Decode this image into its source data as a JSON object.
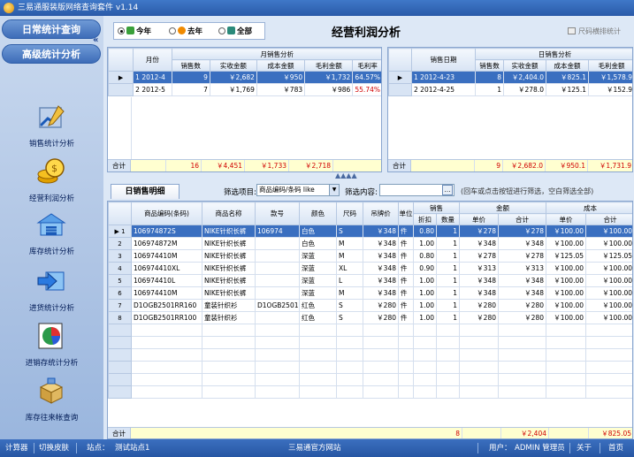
{
  "window": {
    "title": "三易通服装版网络查询套件  v1.14"
  },
  "sidebar": {
    "collapse_symbol": "«",
    "daily_stats": "日常统计查询",
    "advanced_stats": "高级统计分析",
    "items": [
      {
        "label": "销售统计分析",
        "icon": "chart-pen-icon"
      },
      {
        "label": "经营利润分析",
        "icon": "gold-coins-icon"
      },
      {
        "label": "库存统计分析",
        "icon": "warehouse-icon"
      },
      {
        "label": "进货统计分析",
        "icon": "inbound-arrow-icon"
      },
      {
        "label": "进销存统计分析",
        "icon": "pie-chart-icon"
      },
      {
        "label": "库存往来帐查询",
        "icon": "boxes-icon"
      }
    ]
  },
  "period": {
    "options": [
      {
        "label": "今年",
        "selected": true,
        "color": "#3aa03a"
      },
      {
        "label": "去年",
        "selected": false,
        "color": "#f08a00"
      },
      {
        "label": "全部",
        "selected": false,
        "color": "#2a8a7a"
      }
    ]
  },
  "page_title": "经营利润分析",
  "stat_button": "尺码横排统计",
  "monthly": {
    "group_header": "月销售分析",
    "headers": {
      "month": "月份",
      "count": "销售数",
      "actual": "实收金额",
      "cost": "成本金额",
      "gross": "毛利金额",
      "rate": "毛利率"
    },
    "rows": [
      {
        "no": "1",
        "month": "2012-4",
        "count": "9",
        "actual": "￥2,682",
        "cost": "￥950",
        "gross": "￥1,732",
        "rate": "64.57%"
      },
      {
        "no": "2",
        "month": "2012-5",
        "count": "7",
        "actual": "￥1,769",
        "cost": "￥783",
        "gross": "￥986",
        "rate": "55.74%"
      }
    ],
    "total": {
      "label": "合计",
      "count": "16",
      "actual": "￥4,451",
      "cost": "￥1,733",
      "gross": "￥2,718"
    }
  },
  "daily": {
    "group_header": "日销售分析",
    "headers": {
      "date": "销售日期",
      "count": "销售数",
      "actual": "实收金额",
      "cost": "成本金额",
      "gross": "毛利金额"
    },
    "rows": [
      {
        "no": "1",
        "date": "2012-4-23",
        "count": "8",
        "actual": "￥2,404.0",
        "cost": "￥825.1",
        "gross": "￥1,578.9"
      },
      {
        "no": "2",
        "date": "2012-4-25",
        "count": "1",
        "actual": "￥278.0",
        "cost": "￥125.1",
        "gross": "￥152.9"
      }
    ],
    "total": {
      "label": "合计",
      "count": "9",
      "actual": "￥2,682.0",
      "cost": "￥950.1",
      "gross": "￥1,731.9"
    }
  },
  "separator": "▲▲▲▲",
  "detail": {
    "tab": "日销售明细",
    "filter_label": "筛选项目:",
    "filter_value": "商品编码/条码 like",
    "content_label": "筛选内容:",
    "content_value": "",
    "search_icon": "…",
    "hint": "(回车或点击按钮进行筛选，空白筛选全部)",
    "headers": {
      "code": "商品编码(条码)",
      "name": "商品名称",
      "style": "款号",
      "color": "颜色",
      "size": "尺码",
      "tag": "吊牌价",
      "unit": "单位",
      "sales": "销售",
      "discount": "折扣",
      "qty": "数量",
      "amount": "金额",
      "price": "单价",
      "sum": "合计",
      "cost": "成本",
      "cprice": "单价",
      "csum": "合计"
    },
    "rows": [
      {
        "no": "1",
        "code": "106974872S",
        "name": "NIKE针织长裤",
        "style": "106974",
        "color": "白色",
        "size": "S",
        "tag": "￥348",
        "unit": "件",
        "discount": "0.80",
        "qty": "1",
        "price": "￥278",
        "sum": "￥278",
        "cprice": "￥100.00",
        "csum": "￥100.00"
      },
      {
        "no": "2",
        "code": "106974872M",
        "name": "NIKE针织长裤",
        "style": "",
        "color": "白色",
        "size": "M",
        "tag": "￥348",
        "unit": "件",
        "discount": "1.00",
        "qty": "1",
        "price": "￥348",
        "sum": "￥348",
        "cprice": "￥100.00",
        "csum": "￥100.00"
      },
      {
        "no": "3",
        "code": "106974410M",
        "name": "NIKE针织长裤",
        "style": "",
        "color": "深蓝",
        "size": "M",
        "tag": "￥348",
        "unit": "件",
        "discount": "0.80",
        "qty": "1",
        "price": "￥278",
        "sum": "￥278",
        "cprice": "￥125.05",
        "csum": "￥125.05"
      },
      {
        "no": "4",
        "code": "106974410XL",
        "name": "NIKE针织长裤",
        "style": "",
        "color": "深蓝",
        "size": "XL",
        "tag": "￥348",
        "unit": "件",
        "discount": "0.90",
        "qty": "1",
        "price": "￥313",
        "sum": "￥313",
        "cprice": "￥100.00",
        "csum": "￥100.00"
      },
      {
        "no": "5",
        "code": "106974410L",
        "name": "NIKE针织长裤",
        "style": "",
        "color": "深蓝",
        "size": "L",
        "tag": "￥348",
        "unit": "件",
        "discount": "1.00",
        "qty": "1",
        "price": "￥348",
        "sum": "￥348",
        "cprice": "￥100.00",
        "csum": "￥100.00"
      },
      {
        "no": "6",
        "code": "106974410M",
        "name": "NIKE针织长裤",
        "style": "",
        "color": "深蓝",
        "size": "M",
        "tag": "￥348",
        "unit": "件",
        "discount": "1.00",
        "qty": "1",
        "price": "￥348",
        "sum": "￥348",
        "cprice": "￥100.00",
        "csum": "￥100.00"
      },
      {
        "no": "7",
        "code": "D1OGB2501RR160",
        "name": "童装针织衫",
        "style": "D1OGB2501",
        "color": "红色",
        "size": "S",
        "tag": "￥280",
        "unit": "件",
        "discount": "1.00",
        "qty": "1",
        "price": "￥280",
        "sum": "￥280",
        "cprice": "￥100.00",
        "csum": "￥100.00"
      },
      {
        "no": "8",
        "code": "D1OGB2501RR100",
        "name": "童装针织衫",
        "style": "",
        "color": "红色",
        "size": "S",
        "tag": "￥280",
        "unit": "件",
        "discount": "1.00",
        "qty": "1",
        "price": "￥280",
        "sum": "￥280",
        "cprice": "￥100.00",
        "csum": "￥100.00"
      }
    ],
    "total": {
      "label": "合计",
      "qty": "8",
      "sum": "￥2,404",
      "csum": "￥825.05"
    }
  },
  "statusbar": {
    "calculator": "计算器",
    "skin": "切换皮肤",
    "site_label": "站点：",
    "site_value": "测试站点1",
    "website": "三易通官方网站",
    "user_label": "用户：",
    "user_value": "ADMIN 管理员",
    "about": "关于",
    "home": "首页"
  },
  "colors": {
    "selection": "#3a6fc0",
    "total_row": "#ffffd0",
    "titlebar": "#2a5aa8"
  }
}
